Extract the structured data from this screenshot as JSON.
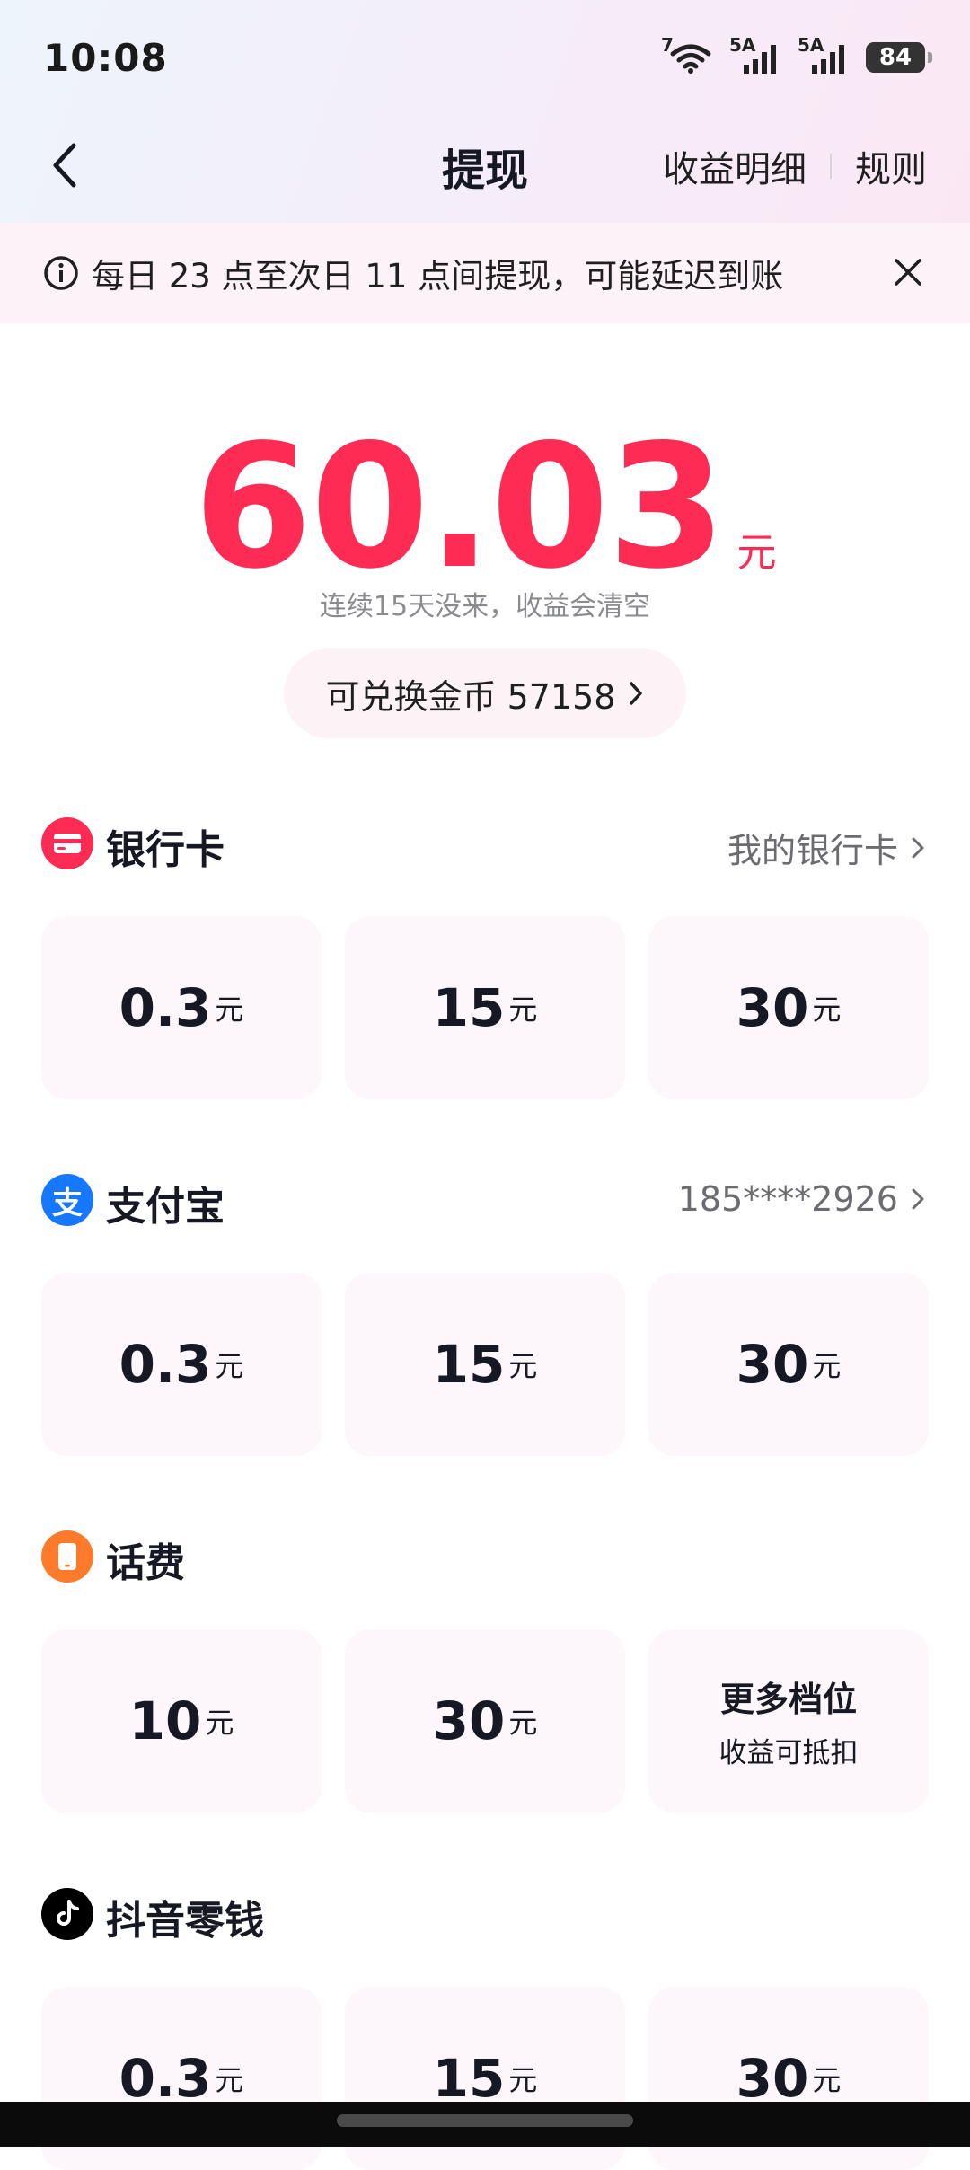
{
  "status_bar": {
    "time": "10:08",
    "wifi_label": "7",
    "sim1_label": "5A",
    "sim2_label": "5A",
    "battery": "84"
  },
  "nav": {
    "title": "提现",
    "income_detail": "收益明细",
    "rules": "规则"
  },
  "notice": {
    "text": "每日 23 点至次日 11 点间提现，可能延迟到账"
  },
  "balance": {
    "amount": "60.03",
    "unit": "元",
    "note": "连续15天没来，收益会清空",
    "coins_label": "可兑换金币 57158"
  },
  "sections": [
    {
      "title": "银行卡",
      "link": "我的银行卡",
      "icon": "bank-card-icon",
      "color": "#fe2c55",
      "options": [
        {
          "value": "0.3",
          "unit": "元"
        },
        {
          "value": "15",
          "unit": "元"
        },
        {
          "value": "30",
          "unit": "元"
        }
      ]
    },
    {
      "title": "支付宝",
      "link": "185****2926",
      "icon": "alipay-icon",
      "color": "#1677ff",
      "options": [
        {
          "value": "0.3",
          "unit": "元"
        },
        {
          "value": "15",
          "unit": "元"
        },
        {
          "value": "30",
          "unit": "元"
        }
      ]
    },
    {
      "title": "话费",
      "link": "",
      "icon": "phone-icon",
      "color": "#ff7a2b",
      "options": [
        {
          "value": "10",
          "unit": "元"
        },
        {
          "value": "30",
          "unit": "元"
        }
      ],
      "more": {
        "line1": "更多档位",
        "line2": "收益可抵扣"
      }
    },
    {
      "title": "抖音零钱",
      "link": "",
      "icon": "douyin-icon",
      "color": "#000000",
      "options": [
        {
          "value": "0.3",
          "unit": "元"
        },
        {
          "value": "15",
          "unit": "元"
        },
        {
          "value": "30",
          "unit": "元"
        }
      ]
    }
  ]
}
